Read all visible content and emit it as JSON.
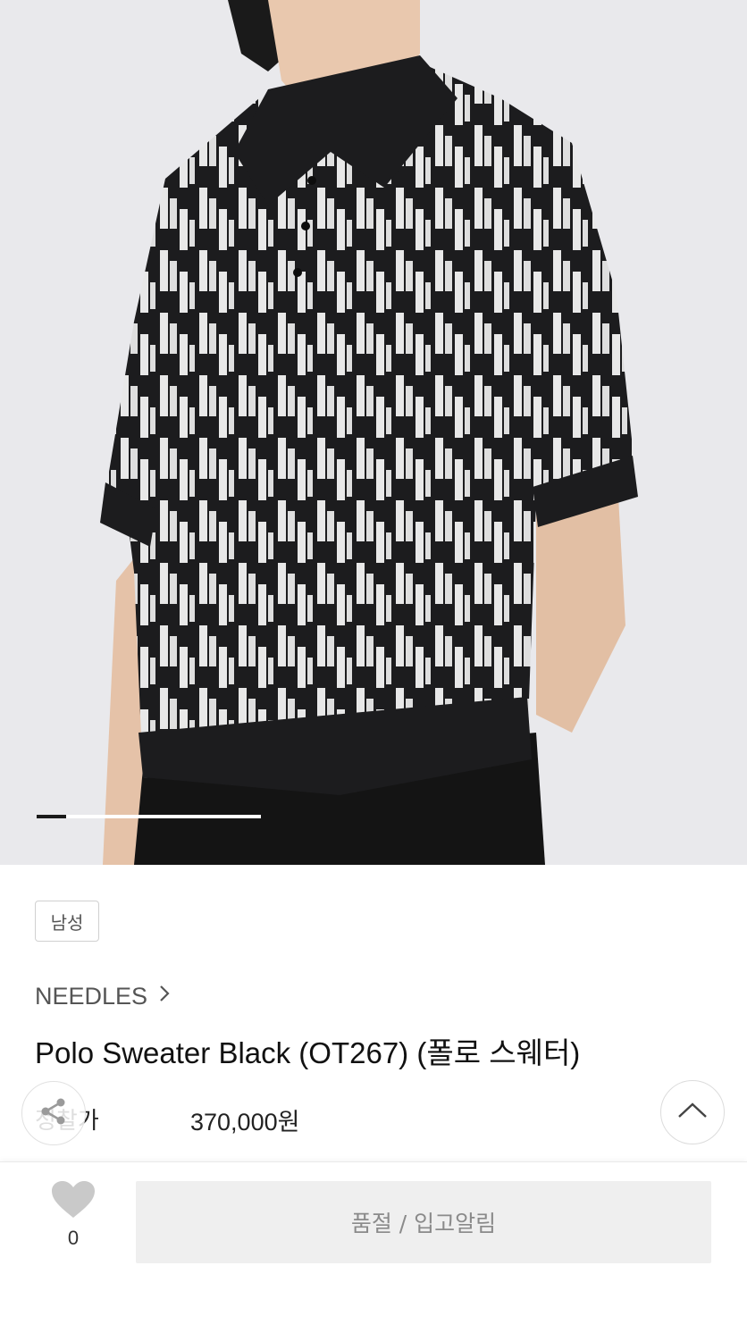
{
  "gallery": {
    "image_alt": "Polo Sweater Black (OT267) (폴로 스웨터)",
    "current_slide": 1,
    "slide_progress": 0.13
  },
  "product": {
    "gender_badge": "남성",
    "brand": "NEEDLES",
    "title": "Polo Sweater Black (OT267) (폴로 스웨터)",
    "price_label": "정찰가",
    "price_value": "370,000원"
  },
  "actions": {
    "share_icon": "share-icon",
    "top_icon": "chevron-up-icon",
    "like_icon": "heart-icon",
    "like_count": "0",
    "soldout_label": "품절 / 입고알림"
  },
  "colors": {
    "accent": "#1a1a1a",
    "button_bg": "#efefef",
    "button_text": "#8a8a8a"
  }
}
